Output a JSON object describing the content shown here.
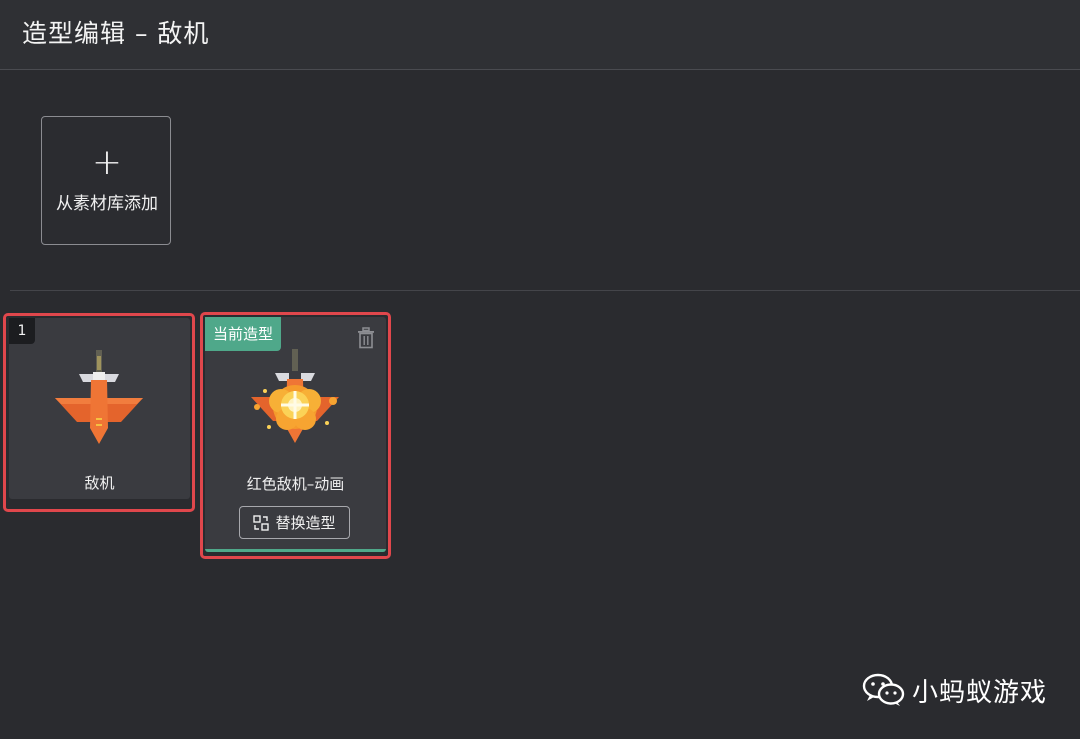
{
  "header": {
    "title": "造型编辑 – 敌机"
  },
  "add_tile": {
    "icon": "plus-icon",
    "label": "从素材库添加"
  },
  "costumes": [
    {
      "index": "1",
      "name": "敌机",
      "sprite": "red-enemy-plane"
    },
    {
      "badge": "当前造型",
      "name": "红色敌机–动画",
      "sprite": "red-enemy-plane-explosion",
      "delete_icon": "trash-icon",
      "replace_label": "替换造型",
      "replace_icon": "swap-icon"
    }
  ],
  "colors": {
    "background": "#2a2b2f",
    "card": "#3a3b40",
    "accent": "#4fa88a",
    "highlight": "#e0474c"
  },
  "watermark": {
    "icon": "wechat-icon",
    "text": "小蚂蚁游戏"
  }
}
